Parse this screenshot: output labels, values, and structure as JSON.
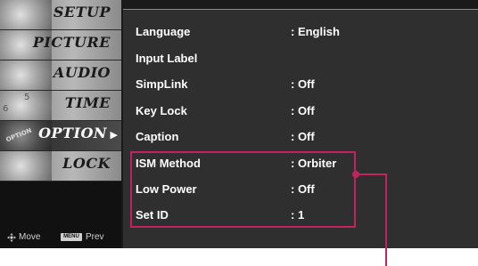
{
  "sidebar": {
    "items": [
      {
        "label": "SETUP",
        "active": false
      },
      {
        "label": "PICTURE",
        "active": false
      },
      {
        "label": "AUDIO",
        "active": false
      },
      {
        "label": "TIME",
        "active": false
      },
      {
        "label": "OPTION",
        "active": true
      },
      {
        "label": "LOCK",
        "active": false
      }
    ],
    "bottom": {
      "move_label": "Move",
      "menu_key": "MENU",
      "prev_label": "Prev"
    }
  },
  "option_menu": {
    "rows": [
      {
        "label": "Language",
        "value": ": English"
      },
      {
        "label": "Input Label",
        "value": ""
      },
      {
        "label": "SimpLink",
        "value": ": Off"
      },
      {
        "label": "Key Lock",
        "value": ": Off"
      },
      {
        "label": "Caption",
        "value": ": Off"
      },
      {
        "label": "ISM Method",
        "value": ": Orbiter"
      },
      {
        "label": "Low Power",
        "value": ": Off"
      },
      {
        "label": "Set ID",
        "value": ": 1"
      }
    ]
  },
  "highlight_color": "#c0245c"
}
